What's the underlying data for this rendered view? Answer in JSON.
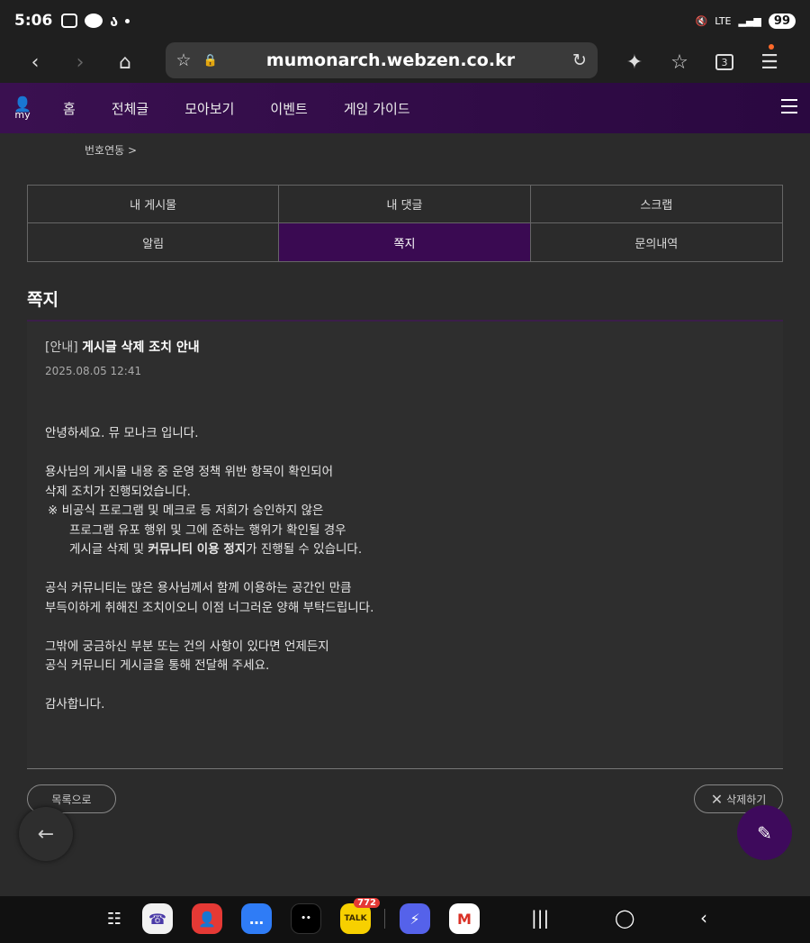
{
  "status": {
    "time": "5:06",
    "battery": "99",
    "network": "LTE"
  },
  "browser": {
    "url": "mumonarch.webzen.co.kr",
    "tab_count": "3"
  },
  "nav": {
    "my_label": "my",
    "items": [
      "홈",
      "전체글",
      "모아보기",
      "이벤트",
      "게임 가이드"
    ]
  },
  "sublink": "번호연동 >",
  "tabs": [
    "내 게시물",
    "내 댓글",
    "스크랩",
    "알림",
    "쪽지",
    "문의내역"
  ],
  "section_title": "쪽지",
  "message": {
    "tag": "[안내]",
    "title": "게시글 삭제 조치 안내",
    "date": "2025.08.05 12:41",
    "p1": "안녕하세요. 뮤 모나크 입니다.",
    "p2_l1": "용사님의 게시물 내용 중 운영 정책 위반 항목이 확인되어",
    "p2_l2": "삭제 조치가 진행되었습니다.",
    "p2_l3": "※ 비공식 프로그램 및 메크로 등 저희가 승인하지 않은",
    "p2_l4": "프로그램 유포 행위 및 그에 준하는 행위가 확인될 경우",
    "p2_l5a": "게시글 삭제 및 ",
    "p2_l5b": "커뮤니티 이용 정지",
    "p2_l5c": "가 진행될 수 있습니다.",
    "p3_l1": "공식 커뮤니티는 많은 용사님께서 함께 이용하는 공간인 만큼",
    "p3_l2": "부득이하게 취해진 조치이오니 이점 너그러운 양해 부탁드립니다.",
    "p4_l1": "그밖에 궁금하신 부분 또는 건의 사항이 있다면 언제든지",
    "p4_l2": "공식 커뮤니티 게시글을 통해 전달해 주세요.",
    "p5": "감사합니다."
  },
  "buttons": {
    "list": "목록으로",
    "delete": "삭제하기"
  },
  "dock": {
    "talk_badge": "772",
    "talk_label": "TALK"
  }
}
